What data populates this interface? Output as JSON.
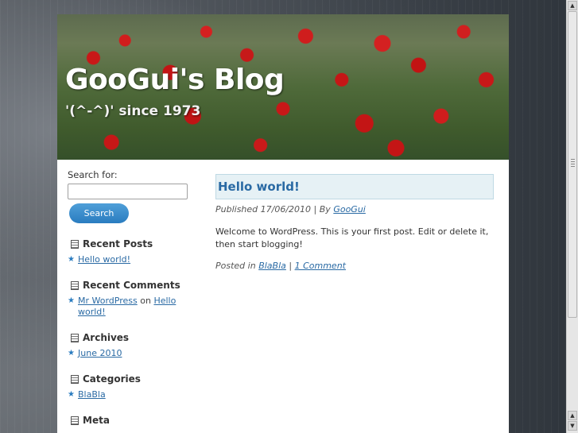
{
  "header": {
    "title": "GooGui's Blog",
    "tagline": "'(^-^)' since 1973"
  },
  "search": {
    "label": "Search for:",
    "input_value": "",
    "button_label": "Search"
  },
  "widgets": {
    "recent_posts": {
      "title": "Recent Posts",
      "items": [
        "Hello world!"
      ]
    },
    "recent_comments": {
      "title": "Recent Comments",
      "author": "Mr WordPress",
      "on": "on",
      "post": "Hello world!"
    },
    "archives": {
      "title": "Archives",
      "items": [
        "June 2010"
      ]
    },
    "categories": {
      "title": "Categories",
      "items": [
        "BlaBla"
      ]
    },
    "meta": {
      "title": "Meta"
    }
  },
  "post": {
    "title": "Hello world!",
    "published_prefix": "Published 17/06/2010 | By",
    "author": "GooGui",
    "body": "Welcome to WordPress. This is your first post. Edit or delete it, then start blogging!",
    "posted_in_prefix": "Posted in",
    "category": "BlaBla",
    "separator": "|",
    "comments_link": "1 Comment"
  },
  "colors": {
    "accent_link": "#2a6aa4",
    "button_blue": "#2a7cc0",
    "title_box_bg": "#e6f1f5"
  }
}
